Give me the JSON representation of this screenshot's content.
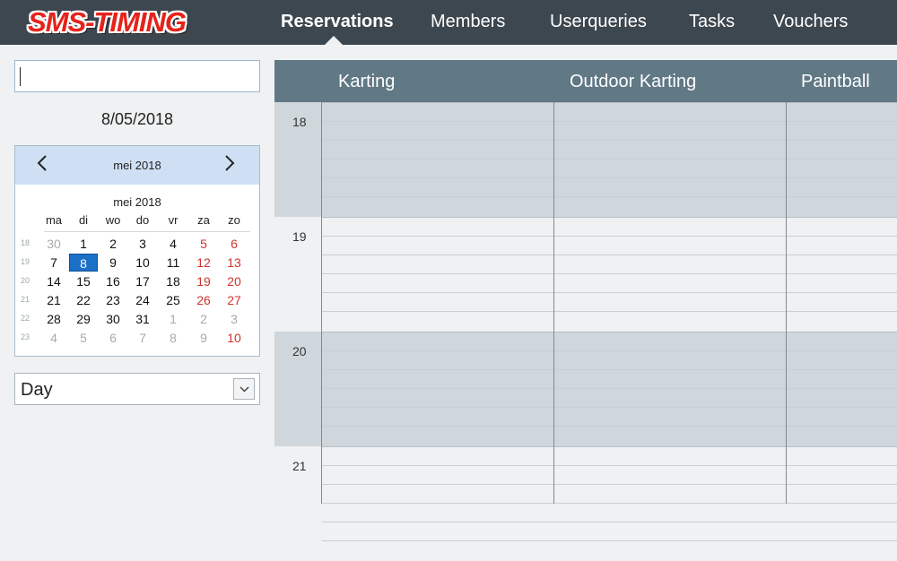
{
  "app": {
    "logo_text": "SMS-TIMING"
  },
  "nav": {
    "items": [
      "Reservations",
      "Members",
      "Userqueries",
      "Tasks",
      "Vouchers"
    ],
    "active": "Reservations"
  },
  "search": {
    "value": "",
    "placeholder": ""
  },
  "date_label": "8/05/2018",
  "calendar": {
    "header_title": "mei 2018",
    "sub_title": "mei 2018",
    "prev_icon": "chevron-left-icon",
    "next_icon": "chevron-right-icon",
    "days_of_week": [
      "ma",
      "di",
      "wo",
      "do",
      "vr",
      "za",
      "zo"
    ],
    "weeks": [
      {
        "week": "18",
        "days": [
          "30",
          "1",
          "2",
          "3",
          "4",
          "5",
          "6"
        ]
      },
      {
        "week": "19",
        "days": [
          "7",
          "8",
          "9",
          "10",
          "11",
          "12",
          "13"
        ]
      },
      {
        "week": "20",
        "days": [
          "14",
          "15",
          "16",
          "17",
          "18",
          "19",
          "20"
        ]
      },
      {
        "week": "21",
        "days": [
          "21",
          "22",
          "23",
          "24",
          "25",
          "26",
          "27"
        ]
      },
      {
        "week": "22",
        "days": [
          "28",
          "29",
          "30",
          "31",
          "1",
          "2",
          "3"
        ]
      },
      {
        "week": "23",
        "days": [
          "4",
          "5",
          "6",
          "7",
          "8",
          "9",
          "10"
        ]
      }
    ],
    "selected_day": "8",
    "colors": {
      "selected": "#1b6fc7",
      "weekend": "#d0342c",
      "muted": "#a9a9a9",
      "header": "#cfe0f4"
    }
  },
  "view_select": {
    "value": "Day",
    "icon": "chevron-down-icon"
  },
  "scheduler": {
    "columns": [
      "Karting",
      "Outdoor Karting",
      "Paintball"
    ],
    "hours": [
      "18",
      "19",
      "20",
      "21"
    ],
    "colors": {
      "header": "#617885",
      "occupied": "#d0d7dc",
      "free": "#eff1f2"
    }
  }
}
